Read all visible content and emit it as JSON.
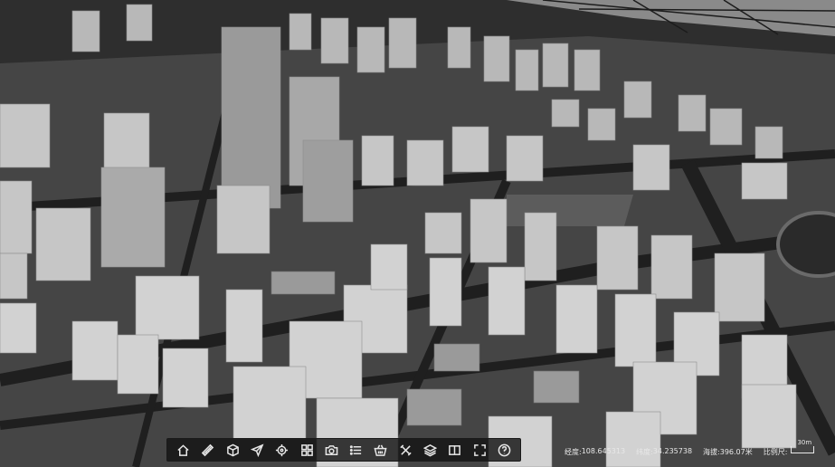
{
  "toolbar": {
    "buttons": [
      {
        "name": "home-icon",
        "title": "home"
      },
      {
        "name": "ruler-icon",
        "title": "measure"
      },
      {
        "name": "cube-icon",
        "title": "3d"
      },
      {
        "name": "send-icon",
        "title": "fly"
      },
      {
        "name": "locate-icon",
        "title": "locate"
      },
      {
        "name": "grid-icon",
        "title": "apps"
      },
      {
        "name": "camera-icon",
        "title": "screenshot"
      },
      {
        "name": "list-icon",
        "title": "list"
      },
      {
        "name": "basket-icon",
        "title": "clear"
      },
      {
        "name": "tools-icon",
        "title": "tools"
      },
      {
        "name": "layers-icon",
        "title": "layers"
      },
      {
        "name": "split-icon",
        "title": "split"
      },
      {
        "name": "fullscreen-icon",
        "title": "fullscreen"
      },
      {
        "name": "help-icon",
        "title": "help"
      }
    ]
  },
  "status": {
    "lon_label": "经度:",
    "lon_value": "108.645313",
    "lat_label": "纬度:",
    "lat_value": "34.235738",
    "alt_label": "海拔:",
    "alt_value": "396.07米",
    "scale_label": "比例尺:",
    "scale_value": "30m"
  },
  "colors": {
    "toolbar_bg": "#141414",
    "icon": "#e6e6e6",
    "ground": "#3a3a3a"
  }
}
